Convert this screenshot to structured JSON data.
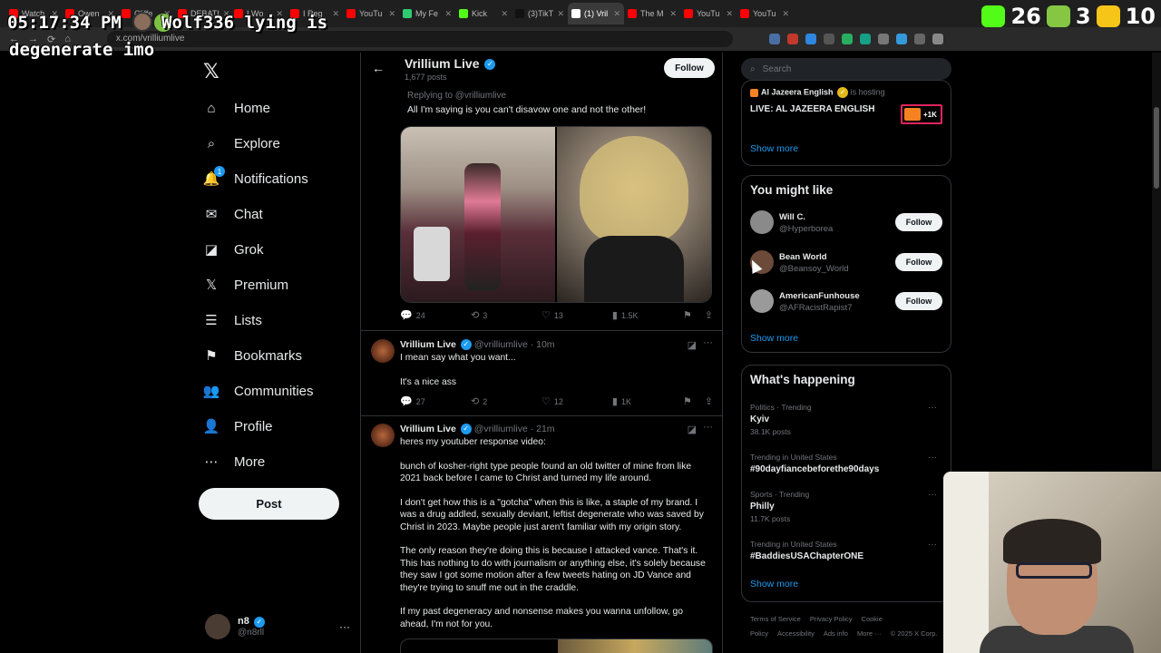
{
  "browser": {
    "tabs": [
      {
        "label": "Watch",
        "color": "#ff0000"
      },
      {
        "label": "Owen",
        "color": "#ff0000"
      },
      {
        "label": "Cliffe",
        "color": "#ff0000"
      },
      {
        "label": "DEBATI",
        "color": "#ff0000"
      },
      {
        "label": "I Wo",
        "color": "#ff0000"
      },
      {
        "label": "I Reg",
        "color": "#ff0000"
      },
      {
        "label": "YouTu",
        "color": "#ff0000"
      },
      {
        "label": "My Fe",
        "color": "#2ecc71"
      },
      {
        "label": "Kick",
        "color": "#53fc18"
      },
      {
        "label": "(3)TikT",
        "color": "#111111"
      },
      {
        "label": "(1) Vril",
        "color": "#ffffff"
      },
      {
        "label": "The M",
        "color": "#ff0000"
      },
      {
        "label": "YouTu",
        "color": "#ff0000"
      },
      {
        "label": "YouTu",
        "color": "#ff0000"
      }
    ],
    "url": "x.com/vrilliumlive"
  },
  "overlay": {
    "time": "05:17:34 PM",
    "chat_user": "Wolf336",
    "chat_message_1": " lying is",
    "chat_message_2": "degenerate imo",
    "stats": [
      {
        "icon": "kick-icon",
        "color": "#53fc18",
        "value": "26"
      },
      {
        "icon": "rumble-icon",
        "color": "#85c742",
        "value": "3"
      },
      {
        "icon": "viewer-icon",
        "color": "#f5c518",
        "value": "10"
      }
    ]
  },
  "sidebar": {
    "items": [
      {
        "label": "Home",
        "icon": "home-icon",
        "glyph": "⌂"
      },
      {
        "label": "Explore",
        "icon": "search-icon",
        "glyph": "⌕"
      },
      {
        "label": "Notifications",
        "icon": "bell-icon",
        "glyph": "🔔",
        "badge": "1"
      },
      {
        "label": "Chat",
        "icon": "mail-icon",
        "glyph": "✉"
      },
      {
        "label": "Grok",
        "icon": "grok-icon",
        "glyph": "◪"
      },
      {
        "label": "Premium",
        "icon": "x-logo-icon",
        "glyph": "𝕏"
      },
      {
        "label": "Lists",
        "icon": "list-icon",
        "glyph": "☰"
      },
      {
        "label": "Bookmarks",
        "icon": "bookmark-icon",
        "glyph": "⚑"
      },
      {
        "label": "Communities",
        "icon": "communities-icon",
        "glyph": "👥"
      },
      {
        "label": "Profile",
        "icon": "profile-icon",
        "glyph": "👤"
      },
      {
        "label": "More",
        "icon": "more-icon",
        "glyph": "⋯"
      }
    ],
    "post_label": "Post",
    "account": {
      "name": "n8",
      "handle": "@n8rll"
    }
  },
  "main": {
    "header": {
      "name": "Vrillium Live",
      "posts": "1,677 posts",
      "follow_label": "Follow"
    },
    "quoted": {
      "replying": "Replying to @vrilliumlive",
      "text": "All I'm saying is you can't disavow one and not the other!",
      "stats": {
        "replies": "24",
        "reposts": "3",
        "likes": "13",
        "views": "1.5K"
      }
    },
    "tweet1": {
      "name": "Vrillium Live",
      "handle": "@vrilliumlive · 10m",
      "lines": [
        "I mean say what you want...",
        "It's a nice ass"
      ],
      "stats": {
        "replies": "27",
        "reposts": "2",
        "likes": "12",
        "views": "1K"
      }
    },
    "tweet2": {
      "name": "Vrillium Live",
      "handle": "@vrilliumlive · 21m",
      "paragraphs": [
        "heres my youtuber response video:",
        "bunch of kosher-right type people found an old twitter of mine from like 2021 back before I came to Christ and turned my life around.",
        "I don't get how this is a \"gotcha\" when this is like, a staple of my brand. I was a drug addled, sexually deviant, leftist degenerate who was saved by Christ in 2023. Maybe people just aren't familiar with my origin story.",
        "The only reason they're doing this is because I attacked vance. That's it. This has nothing to do with journalism or anything else, it's solely because they saw I got some motion after a few tweets hating on JD Vance and they're trying to snuff me out in the craddle.",
        "If my past degeneracy and nonsense makes you wanna unfollow, go ahead, I'm not for you."
      ]
    }
  },
  "right": {
    "search_placeholder": "Search",
    "live": {
      "host_name": "Al Jazeera English",
      "host_suffix": "is hosting",
      "title": "LIVE: AL JAZEERA ENGLISH",
      "listeners": "+1K",
      "show_more": "Show more"
    },
    "wtf": {
      "title": "You might like",
      "users": [
        {
          "name": "Will C.",
          "handle": "@Hyperborea"
        },
        {
          "name": "Bean World",
          "handle": "@Beansoy_World"
        },
        {
          "name": "AmericanFunhouse",
          "handle": "@AFRacistRapist7"
        }
      ],
      "follow_label": "Follow",
      "show_more": "Show more"
    },
    "trending": {
      "title": "What's happening",
      "items": [
        {
          "context": "Politics · Trending",
          "name": "Kyiv",
          "count": "38.1K posts"
        },
        {
          "context": "Trending in United States",
          "name": "#90dayfiancebeforethe90days",
          "count": ""
        },
        {
          "context": "Sports · Trending",
          "name": "Philly",
          "count": "11.7K posts"
        },
        {
          "context": "Trending in United States",
          "name": "#BaddiesUSAChapterONE",
          "count": ""
        }
      ],
      "show_more": "Show more"
    },
    "footer": [
      "Terms of Service",
      "Privacy Policy",
      "Cookie Policy",
      "Accessibility",
      "Ads info",
      "More ···",
      "© 2025 X Corp."
    ]
  }
}
